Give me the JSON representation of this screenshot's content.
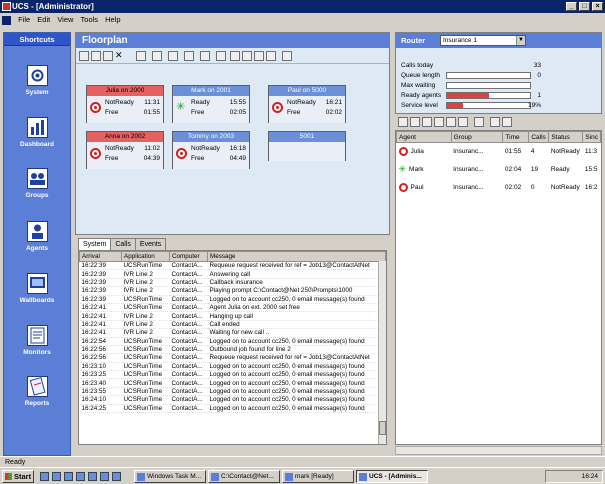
{
  "window": {
    "title": "UCS - [Administrator]"
  },
  "menu": [
    "File",
    "Edit",
    "View",
    "Tools",
    "Help"
  ],
  "shortcuts": {
    "title": "Shortcuts",
    "items": [
      {
        "label": "System",
        "icon": "system-icon"
      },
      {
        "label": "Dashboard",
        "icon": "dashboard-icon"
      },
      {
        "label": "Groups",
        "icon": "groups-icon"
      },
      {
        "label": "Agents",
        "icon": "agents-icon"
      },
      {
        "label": "Wallboards",
        "icon": "wallboards-icon"
      },
      {
        "label": "Monitors",
        "icon": "monitors-icon"
      },
      {
        "label": "Reports",
        "icon": "reports-icon"
      }
    ]
  },
  "floorplan": {
    "title": "Floorplan",
    "cards": [
      {
        "header": "Julia on 2000",
        "header_color": "red",
        "status": "NotReady",
        "status_time": "11:31",
        "free_label": "Free",
        "free_time": "01:55",
        "ready": false
      },
      {
        "header": "Mark on 2001",
        "header_color": "blue",
        "status": "Ready",
        "status_time": "15:55",
        "free_label": "Free",
        "free_time": "02:05",
        "ready": true
      },
      {
        "header": "Paul on 5000",
        "header_color": "blue",
        "status": "NotReady",
        "status_time": "16:21",
        "free_label": "Free",
        "free_time": "02:02",
        "ready": false
      },
      {
        "header": "Anna on 2002",
        "header_color": "red",
        "status": "NotReady",
        "status_time": "11:02",
        "free_label": "Free",
        "free_time": "04:39",
        "ready": false
      },
      {
        "header": "Tommy on 2003",
        "header_color": "blue",
        "status": "NotReady",
        "status_time": "16:18",
        "free_label": "Free",
        "free_time": "04:49",
        "ready": false
      },
      {
        "header": "5001",
        "header_color": "blue",
        "empty": true
      }
    ]
  },
  "log": {
    "tabs": [
      "System",
      "Calls",
      "Events"
    ],
    "active_tab": "System",
    "columns": [
      "Arrival",
      "Application",
      "Computer",
      "Message"
    ],
    "rows": [
      [
        "16:22:39",
        "UCSRunTime",
        "ContactA...",
        "Requeue request received for ref = Job13@ContactAtNet"
      ],
      [
        "16:22:39",
        "IVR Line 2",
        "ContactA...",
        "Answering call"
      ],
      [
        "16:22:39",
        "IVR Line 2",
        "ContactA...",
        "Callback insurance"
      ],
      [
        "16:22:39",
        "IVR Line 2",
        "ContactA...",
        "Playing prompt C:\\Contact@Net 250\\Prompts\\1000"
      ],
      [
        "16:22:39",
        "UCSRunTime",
        "ContactA...",
        "Logged on to account cc250, 0 email message(s) found"
      ],
      [
        "16:22:41",
        "UCSRunTime",
        "ContactA...",
        "Agent Julia on ext. 2000 set free"
      ],
      [
        "16:22:41",
        "IVR Line 2",
        "ContactA...",
        "Hanging up call"
      ],
      [
        "16:22:41",
        "IVR Line 2",
        "ContactA...",
        "Call ended"
      ],
      [
        "16:22:41",
        "IVR Line 2",
        "ContactA...",
        "Waiting for new call .."
      ],
      [
        "16:22:54",
        "UCSRunTime",
        "ContactA...",
        "Logged on to account cc250, 0 email message(s) found"
      ],
      [
        "16:22:56",
        "UCSRunTime",
        "ContactA...",
        "Outbound job found for line 2"
      ],
      [
        "16:22:56",
        "UCSRunTime",
        "ContactA...",
        "Requeue request received for ref = Job13@ContactAtNet"
      ],
      [
        "16:23:10",
        "UCSRunTime",
        "ContactA...",
        "Logged on to account cc250, 0 email message(s) found"
      ],
      [
        "16:23:25",
        "UCSRunTime",
        "ContactA...",
        "Logged on to account cc250, 0 email message(s) found"
      ],
      [
        "16:23:40",
        "UCSRunTime",
        "ContactA...",
        "Logged on to account cc250, 0 email message(s) found"
      ],
      [
        "16:23:55",
        "UCSRunTime",
        "ContactA...",
        "Logged on to account cc250, 0 email message(s) found"
      ],
      [
        "16:24:10",
        "UCSRunTime",
        "ContactA...",
        "Logged on to account cc250, 0 email message(s) found"
      ],
      [
        "16:24:25",
        "UCSRunTime",
        "ContactA...",
        "Logged on to account cc250, 0 email message(s) found"
      ]
    ]
  },
  "router": {
    "label": "Router",
    "selected": "Insurance 1",
    "stats": [
      {
        "label": "Calls today",
        "value": "33",
        "bar": null
      },
      {
        "label": "Queue length",
        "value": "0",
        "bar": 0
      },
      {
        "label": "Max waiting",
        "value": "",
        "bar": 0
      },
      {
        "label": "Ready agents",
        "value": "1",
        "bar": 0.5
      },
      {
        "label": "Service level",
        "value": "19%",
        "bar": 0.19
      }
    ]
  },
  "agents": {
    "columns": [
      "Agent",
      "Group",
      "Time",
      "Calls",
      "Status",
      "Sinc"
    ],
    "rows": [
      {
        "agent": "Julia",
        "group": "Insuranc...",
        "time": "01:55",
        "calls": "4",
        "status": "NotReady",
        "since": "11:3",
        "ready": false
      },
      {
        "agent": "Mark",
        "group": "Insuranc...",
        "time": "02:04",
        "calls": "19",
        "status": "Ready",
        "since": "15:5",
        "ready": true
      },
      {
        "agent": "Paul",
        "group": "Insuranc...",
        "time": "02:02",
        "calls": "0",
        "status": "NotReady",
        "since": "16:2",
        "ready": false
      }
    ]
  },
  "statusbar": {
    "text": "Ready"
  },
  "taskbar": {
    "start": "Start",
    "tasks": [
      "Windows Task M...",
      "C:\\Contact@Net...",
      "mark [Ready]",
      "UCS - [Adminis..."
    ],
    "active_task": 3,
    "clock": "16:24"
  },
  "colors": {
    "accent": "#5b7fd6",
    "notready": "#e56060",
    "ready": "#2a9a2a"
  }
}
